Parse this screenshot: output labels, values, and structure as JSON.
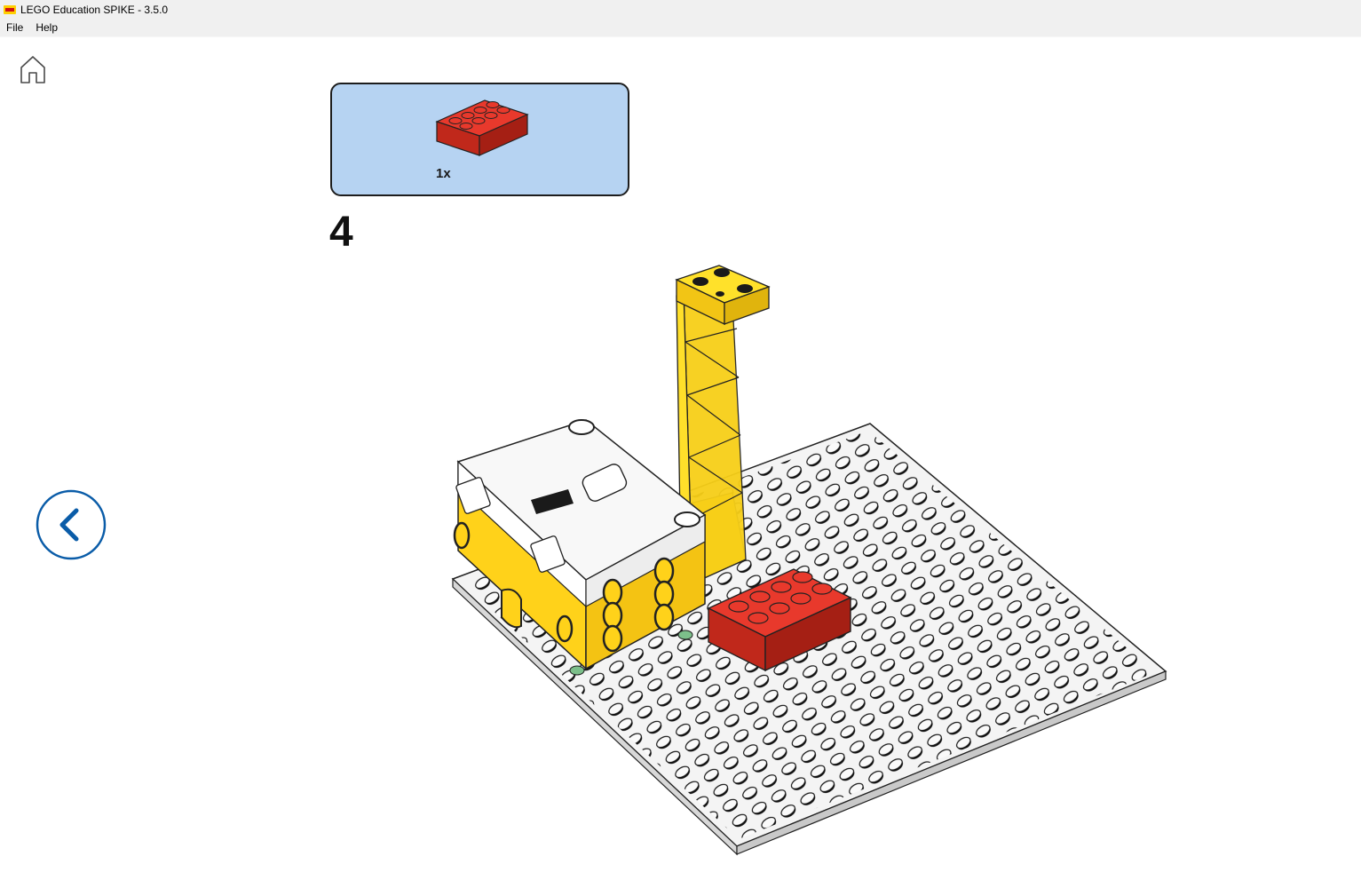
{
  "window": {
    "title": "LEGO Education SPIKE - 3.5.0"
  },
  "menu": [
    {
      "label": "File"
    },
    {
      "label": "Help"
    }
  ],
  "instructions": {
    "parts": [
      {
        "name": "red brick 2x4",
        "quantity": "1x",
        "color": "#d8281b"
      }
    ],
    "step_number": "4"
  },
  "icons": {
    "home": "home-icon",
    "back": "chevron-left-icon"
  },
  "colors": {
    "accent": "#0a5ca8",
    "parts_box": "#b6d3f2",
    "hub_yellow": "#ffd21a",
    "brick_red": "#d8281b"
  }
}
